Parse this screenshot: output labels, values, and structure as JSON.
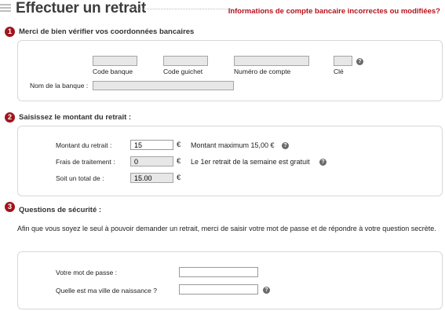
{
  "header": {
    "title": "Effectuer un retrait",
    "link": "Informations de compte bancaire incorrectes ou modifiées?"
  },
  "section1": {
    "number": "1",
    "title": "Merci de bien vérifier vos coordonnées bancaires",
    "fields": {
      "code_banque": "Code banque",
      "code_guichet": "Code guichet",
      "numero_compte": "Numéro de compte",
      "cle": "Clé"
    },
    "nom_banque_label": "Nom de la banque :"
  },
  "section2": {
    "number": "2",
    "title": "Saisissez le montant du retrait :",
    "montant_label": "Montant du retrait :",
    "montant_value": "15",
    "montant_info": "Montant maximum 15,00 €",
    "frais_label": "Frais de traitement :",
    "frais_value": "0",
    "frais_info": "Le 1er retrait de la semaine est gratuit",
    "total_label": "Soit un total de :",
    "total_value": "15.00",
    "currency": "€"
  },
  "section3": {
    "number": "3",
    "title": "Questions de sécurité :",
    "intro": "Afin que vous soyez le seul à pouvoir demander un retrait, merci de saisir votre mot de passe et de répondre à votre question secrète.",
    "password_label": "Votre mot de passe :",
    "question_label": "Quelle est ma ville de naissance ?"
  },
  "icons": {
    "help": "question-mark-icon"
  },
  "colors": {
    "accent": "#a0151d",
    "link": "#b5121b"
  }
}
